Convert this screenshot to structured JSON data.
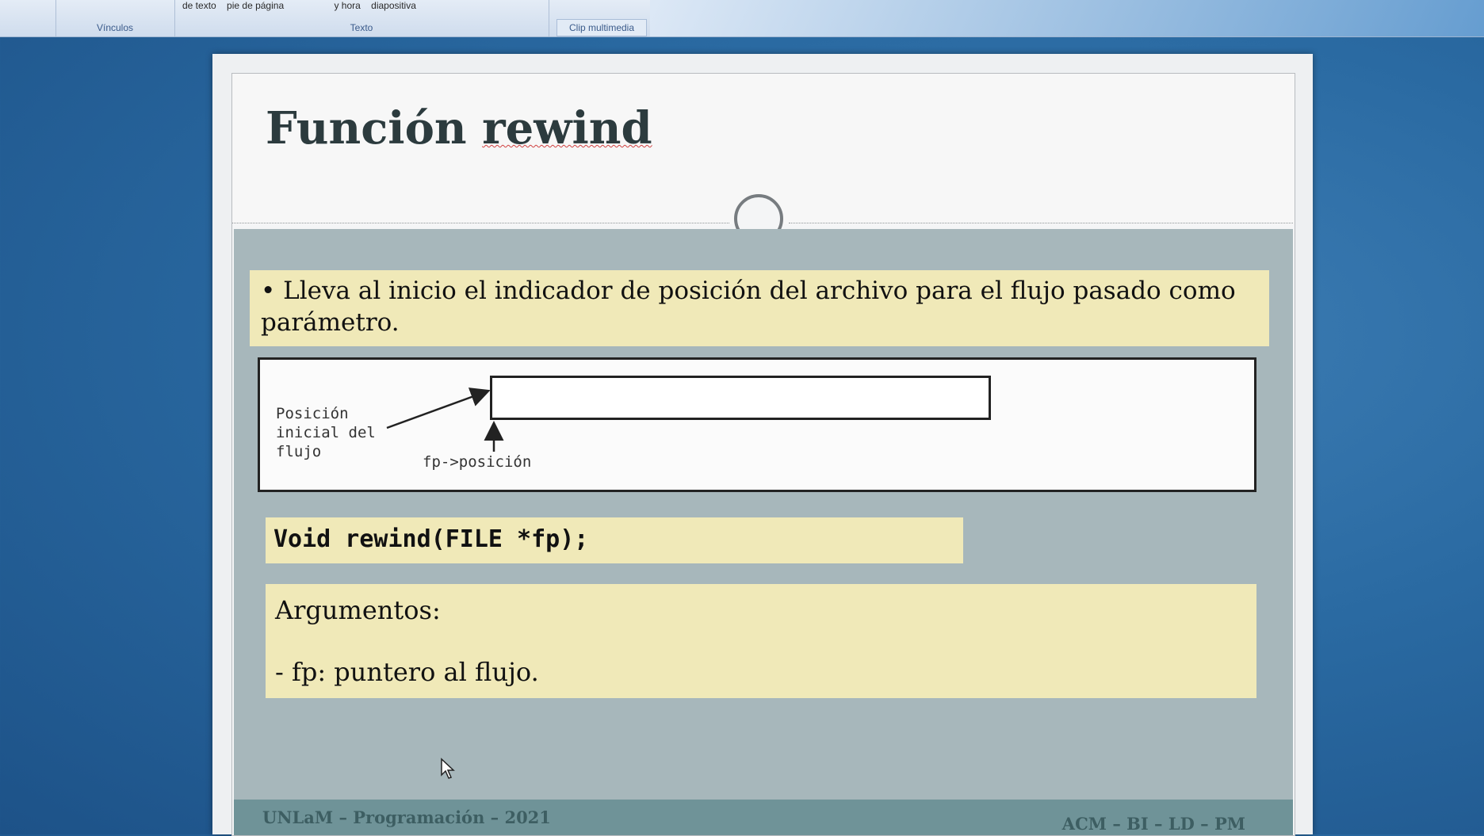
{
  "ribbon": {
    "groups": [
      {
        "label": "Vínculos",
        "items": []
      },
      {
        "label": "Texto",
        "items": [
          "de texto",
          "pie de página",
          "y hora",
          "diapositiva"
        ]
      },
      {
        "label": "Clip multimedia",
        "items": []
      }
    ]
  },
  "slide": {
    "title_plain": "Función ",
    "title_word": "rewind",
    "bullet": "• Lleva al inicio el indicador de posición del archivo para el flujo pasado como parámetro.",
    "diagram": {
      "start_label": "Posición\ninicial del\nflujo",
      "pointer_label": "fp->posición"
    },
    "code": "Void rewind(FILE *fp);",
    "arguments_title": "Argumentos:",
    "arguments_item": "- fp: puntero al flujo.",
    "footer_left": "UNLaM – Programación – 2021",
    "footer_right": "ACM – BI – LD – PM"
  },
  "colors": {
    "highlight": "#f0e9b8",
    "body_bg": "#a7b7bb",
    "footer_bg": "#6f9398",
    "title_color": "#2c3b3e"
  },
  "icons": [
    "mouse-pointer-icon",
    "separator-circle-icon"
  ]
}
